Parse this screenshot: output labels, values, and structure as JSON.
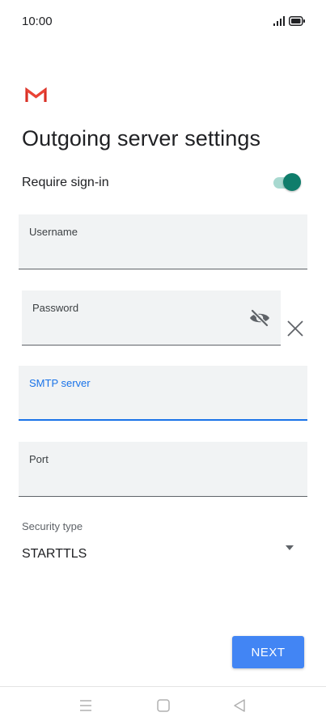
{
  "status_bar": {
    "time": "10:00",
    "signal_icon": "cell-signal-icon",
    "battery_icon": "battery-icon"
  },
  "app": {
    "logo_icon": "gmail-icon"
  },
  "page": {
    "title": "Outgoing server settings"
  },
  "require_signin": {
    "label": "Require sign-in",
    "enabled": true,
    "accent": "#0f7d6b"
  },
  "fields": {
    "username": {
      "label": "Username",
      "value": ""
    },
    "password": {
      "label": "Password",
      "value": "",
      "visibility_icon": "eye-off-icon",
      "clear_icon": "close-icon"
    },
    "smtp": {
      "label": "SMTP server",
      "value": "",
      "focused": true,
      "accent": "#1a73e8"
    },
    "port": {
      "label": "Port",
      "value": ""
    }
  },
  "security_type": {
    "label": "Security type",
    "selected": "STARTTLS",
    "arrow_icon": "dropdown-arrow-icon"
  },
  "actions": {
    "next_label": "NEXT",
    "next_color": "#4285f4"
  },
  "nav_bar": {
    "menu_icon": "menu-icon",
    "home_icon": "home-icon",
    "back_icon": "back-icon"
  }
}
